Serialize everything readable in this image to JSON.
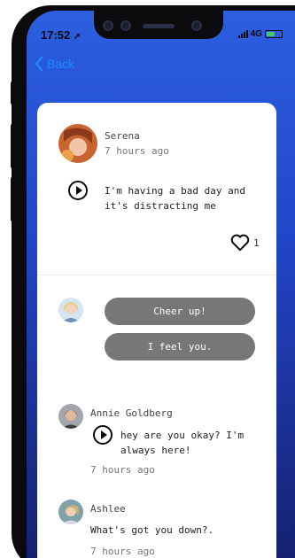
{
  "status_bar": {
    "time": "17:52",
    "network": "4G"
  },
  "nav": {
    "back_label": "Back"
  },
  "post": {
    "author": "Serena",
    "time": "7 hours ago",
    "text": "I'm having a bad day and it's distracting me",
    "like_count": "1"
  },
  "quick_replies": [
    {
      "label": "Cheer up!"
    },
    {
      "label": "I feel you."
    }
  ],
  "comments": [
    {
      "author": "Annie Goldberg",
      "text": "hey are you okay? I'm always here!",
      "time": "7 hours ago"
    },
    {
      "author": "Ashlee",
      "text": "What's got you down?.",
      "time": "7 hours ago"
    }
  ],
  "colors": {
    "accent": "#1f8bff",
    "pill": "#787676",
    "gradient_top": "#2d5fe0",
    "gradient_bottom": "#141f6a"
  }
}
